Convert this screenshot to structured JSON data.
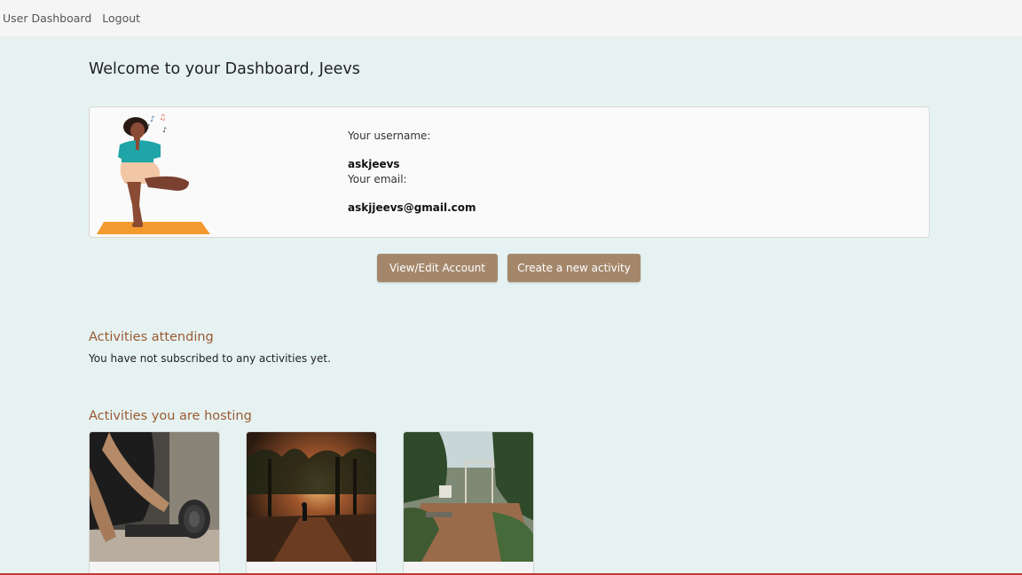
{
  "nav": {
    "links": [
      "User Dashboard",
      "Logout"
    ]
  },
  "header": {
    "welcome": "Welcome to your Dashboard, Jeevs"
  },
  "profile": {
    "username_label": "Your username:",
    "username": "askjeevs",
    "email_label": "Your email:",
    "email": "askjjeevs@gmail.com"
  },
  "actions": {
    "edit_account": "View/Edit Account",
    "create_activity": "Create a new activity"
  },
  "attending": {
    "title": "Activities attending",
    "empty_message": "You have not subscribed to any activities yet."
  },
  "hosting": {
    "title": "Activities you are hosting",
    "cards": [
      {
        "image": "yoga-mat-photo"
      },
      {
        "image": "forest-sunset-walk-photo"
      },
      {
        "image": "garden-photo"
      }
    ]
  },
  "colors": {
    "background": "#e5f2f1",
    "button": "#a4876b",
    "section_title": "#9c5a33",
    "accent_line": "#c1372f"
  }
}
